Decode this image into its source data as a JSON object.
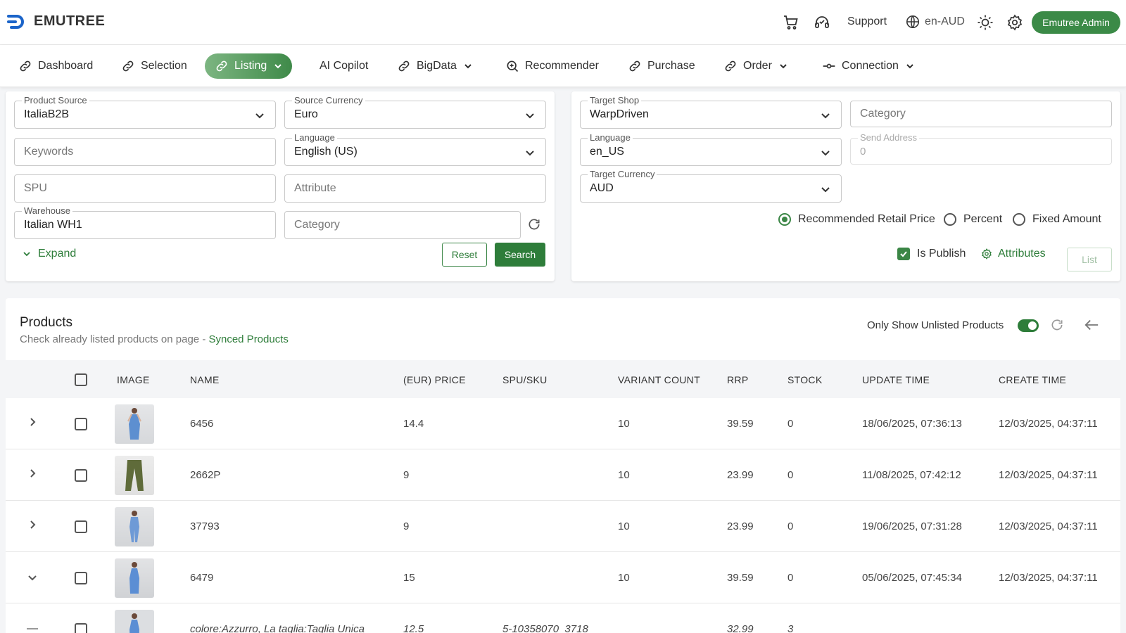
{
  "brand": {
    "name": "EMUTREE",
    "accent": "#2e7d3a"
  },
  "header": {
    "support_label": "Support",
    "locale_label": "en-AUD",
    "user_button": "Emutree Admin"
  },
  "nav": {
    "items": [
      {
        "label": "Dashboard",
        "icon": "link-icon"
      },
      {
        "label": "Selection",
        "icon": "link-icon"
      },
      {
        "label": "Listing",
        "icon": "link-icon",
        "active": true
      },
      {
        "label": "AI Copilot"
      },
      {
        "label": "BigData",
        "icon": "link-icon"
      },
      {
        "label": "Recommender",
        "icon": "search-icon"
      },
      {
        "label": "Purchase",
        "icon": "link-icon"
      },
      {
        "label": "Order",
        "icon": "link-icon"
      },
      {
        "label": "Connection",
        "icon": "connection-icon"
      }
    ]
  },
  "search_panel": {
    "product_source": {
      "label": "Product Source",
      "value": "ItaliaB2B"
    },
    "source_currency": {
      "label": "Source Currency",
      "value": "Euro"
    },
    "keywords": {
      "placeholder": "Keywords"
    },
    "language": {
      "label": "Language",
      "value": "English (US)"
    },
    "spu": {
      "placeholder": "SPU"
    },
    "attribute": {
      "placeholder": "Attribute"
    },
    "warehouse": {
      "label": "Warehouse",
      "value": "Italian WH1"
    },
    "category": {
      "placeholder": "Category"
    },
    "expand_label": "Expand",
    "reset_label": "Reset",
    "search_label": "Search"
  },
  "listing_panel": {
    "target_shop": {
      "label": "Target Shop",
      "value": "WarpDriven"
    },
    "category": {
      "placeholder": "Category"
    },
    "language": {
      "label": "Language",
      "value": "en_US"
    },
    "send_address": {
      "label": "Send Address",
      "value": "0"
    },
    "target_currency": {
      "label": "Target Currency",
      "value": "AUD"
    },
    "price_modes": [
      "Recommended Retail Price",
      "Percent",
      "Fixed Amount"
    ],
    "selected_price_mode": "Recommended Retail Price",
    "is_publish_label": "Is Publish",
    "is_publish_checked": true,
    "attributes_label": "Attributes",
    "list_label": "List"
  },
  "products": {
    "title": "Products",
    "subtitle": "Check already listed products on page - ",
    "synced_link": "Synced Products",
    "only_unlisted_label": "Only Show Unlisted Products",
    "only_unlisted_on": true,
    "columns": [
      "IMAGE",
      "NAME",
      "(EUR) PRICE",
      "SPU/SKU",
      "VARIANT COUNT",
      "RRP",
      "STOCK",
      "UPDATE TIME",
      "CREATE TIME"
    ],
    "rows": [
      {
        "name": "6456",
        "price": "14.4",
        "spu": "",
        "variant_count": "10",
        "rrp": "39.59",
        "stock": "0",
        "update_time": "18/06/2025, 07:36:13",
        "create_time": "12/03/2025, 04:37:11",
        "expanded": false
      },
      {
        "name": "2662P",
        "price": "9",
        "spu": "",
        "variant_count": "10",
        "rrp": "23.99",
        "stock": "0",
        "update_time": "11/08/2025, 07:42:12",
        "create_time": "12/03/2025, 04:37:11",
        "expanded": false
      },
      {
        "name": "37793",
        "price": "9",
        "spu": "",
        "variant_count": "10",
        "rrp": "23.99",
        "stock": "0",
        "update_time": "19/06/2025, 07:31:28",
        "create_time": "12/03/2025, 04:37:11",
        "expanded": false
      },
      {
        "name": "6479",
        "price": "15",
        "spu": "",
        "variant_count": "10",
        "rrp": "39.59",
        "stock": "0",
        "update_time": "05/06/2025, 07:45:34",
        "create_time": "12/03/2025, 04:37:11",
        "expanded": true
      }
    ],
    "sub_row": {
      "name": "colore:Azzurro, La taglia:Taglia Unica",
      "price": "12.5",
      "spu": "5-10358070_3718",
      "rrp": "32.99",
      "stock": "3"
    }
  }
}
